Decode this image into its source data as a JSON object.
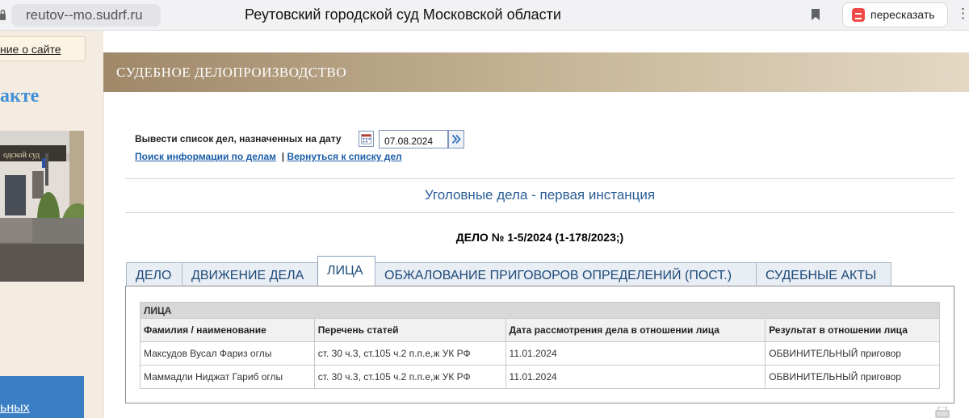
{
  "browser": {
    "url": "reutov--mo.sudrf.ru",
    "page_title": "Реутовский городской суд Московской области",
    "retell_label": "пересказать",
    "menu_glyph": "⋮"
  },
  "sidebar": {
    "about_link": "ние о сайте",
    "vk_heading": "акте",
    "blue_link": "ьных"
  },
  "header": {
    "title": "СУДЕБНОЕ ДЕЛОПРОИЗВОДСТВО"
  },
  "filter": {
    "date_label": "Вывести список дел, назначенных на дату",
    "date_value": "07.08.2024",
    "search_link": "Поиск информации по делам",
    "separator": "|",
    "back_link": "Вернуться к списку дел"
  },
  "section_title": "Уголовные дела - первая инстанция",
  "case_title": "ДЕЛО № 1-5/2024 (1-178/2023;)",
  "tabs": [
    {
      "label": "ДЕЛО",
      "active": false
    },
    {
      "label": "ДВИЖЕНИЕ ДЕЛА",
      "active": false
    },
    {
      "label": "ЛИЦА",
      "active": true
    },
    {
      "label": "ОБЖАЛОВАНИЕ ПРИГОВОРОВ ОПРЕДЕЛЕНИЙ (ПОСТ.)",
      "active": false
    },
    {
      "label": "СУДЕБНЫЕ АКТЫ",
      "active": false
    }
  ],
  "persons_table": {
    "caption": "ЛИЦА",
    "columns": [
      "Фамилия / наименование",
      "Перечень статей",
      "Дата рассмотрения дела в отношении лица",
      "Результат в отношении лица"
    ],
    "rows": [
      [
        "Максудов Вусал Фариз оглы",
        "ст. 30 ч.3, ст.105 ч.2 п.п.е,ж УК РФ",
        "11.01.2024",
        "ОБВИНИТЕЛЬНЫЙ приговор"
      ],
      [
        "Маммадли Ниджат Гариб оглы",
        "ст. 30 ч.3, ст.105 ч.2 п.п.е,ж УК РФ",
        "11.01.2024",
        "ОБВИНИТЕЛЬНЫЙ приговор"
      ]
    ]
  },
  "colors": {
    "link_blue": "#1b5ea8",
    "section_blue": "#2a5d96",
    "header_brown": "#a08869",
    "sidebar_beige": "#f5ece1",
    "sidebar_blue": "#3a7fc4",
    "vk_blue": "#3d8fd6"
  }
}
